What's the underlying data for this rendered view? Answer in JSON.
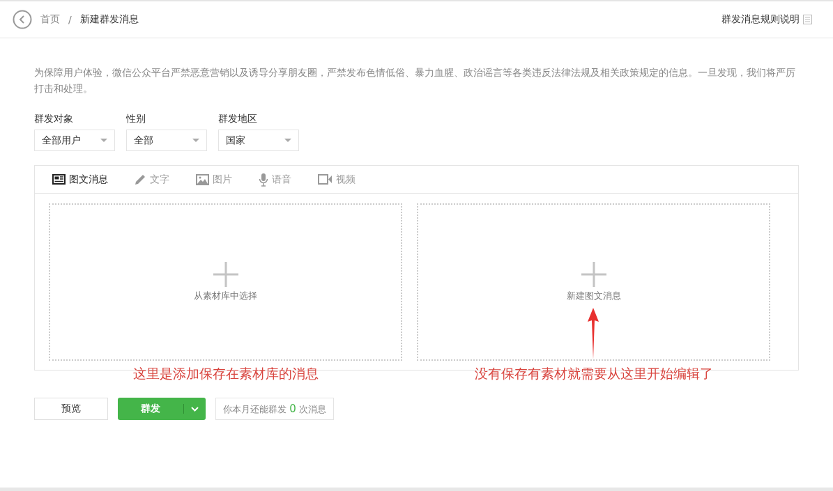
{
  "breadcrumb": {
    "home": "首页",
    "separator": "/",
    "current": "新建群发消息"
  },
  "rules_link": "群发消息规则说明",
  "notice": "为保障用户体验，微信公众平台严禁恶意营销以及诱导分享朋友圈，严禁发布色情低俗、暴力血腥、政治谣言等各类违反法律法规及相关政策规定的信息。一旦发现，我们将严厉打击和处理。",
  "filters": [
    {
      "label": "群发对象",
      "value": "全部用户"
    },
    {
      "label": "性别",
      "value": "全部"
    },
    {
      "label": "群发地区",
      "value": "国家"
    }
  ],
  "tabs": [
    {
      "kind": "news",
      "label": "图文消息",
      "selected": true
    },
    {
      "kind": "text",
      "label": "文字",
      "selected": false
    },
    {
      "kind": "image",
      "label": "图片",
      "selected": false
    },
    {
      "kind": "voice",
      "label": "语音",
      "selected": false
    },
    {
      "kind": "video",
      "label": "视频",
      "selected": false
    }
  ],
  "cards": [
    {
      "label": "从素材库中选择",
      "annotation": "这里是添加保存在素材库的消息",
      "arrow": false
    },
    {
      "label": "新建图文消息",
      "annotation": "没有保存有素材就需要从这里开始编辑了",
      "arrow": true
    }
  ],
  "actions": {
    "preview": "预览",
    "send": "群发",
    "quota_before": "你本月还能群发",
    "quota_count": "0",
    "quota_after": "次消息"
  }
}
